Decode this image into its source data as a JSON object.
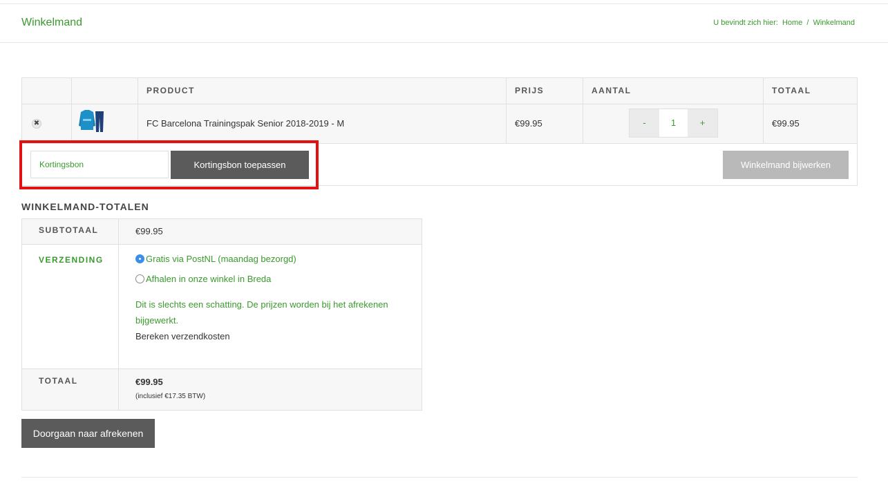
{
  "header": {
    "title": "Winkelmand",
    "breadcrumb_prefix": "U bevindt zich hier:",
    "breadcrumb_home": "Home",
    "breadcrumb_sep": "/",
    "breadcrumb_current": "Winkelmand"
  },
  "cart": {
    "columns": [
      "",
      "",
      "PRODUCT",
      "PRIJS",
      "AANTAL",
      "TOTAAL"
    ],
    "items": [
      {
        "remove_icon": "close-icon",
        "product": "FC Barcelona Trainingspak Senior 2018-2019 - M",
        "price": "€99.95",
        "qty_minus": "-",
        "quantity": "1",
        "qty_plus": "+",
        "total": "€99.95"
      }
    ],
    "coupon_placeholder": "Kortingsbon",
    "coupon_button": "Kortingsbon toepassen",
    "update_button": "Winkelmand bijwerken"
  },
  "totals": {
    "title": "WINKELMAND-TOTALEN",
    "subtotal_label": "SUBTOTAAL",
    "subtotal_value": "€99.95",
    "shipping_label": "VERZENDING",
    "shipping_options": [
      {
        "label": "Gratis via PostNL (maandag bezorgd)",
        "selected": true
      },
      {
        "label": "Afhalen in onze winkel in Breda",
        "selected": false
      }
    ],
    "shipping_note": "Dit is slechts een schatting. De prijzen worden bij het afrekenen bijgewerkt.",
    "shipping_calc": "Bereken verzendkosten",
    "total_label": "TOTAAL",
    "total_value": "€99.95",
    "total_tax": "(inclusief €17.35 BTW)"
  },
  "checkout_button": "Doorgaan naar afrekenen",
  "colors": {
    "accent_green": "#3a9a2e",
    "button_dark": "#5b5b5b",
    "button_disabled": "#b9b9b9",
    "highlight_red": "#e31212"
  }
}
